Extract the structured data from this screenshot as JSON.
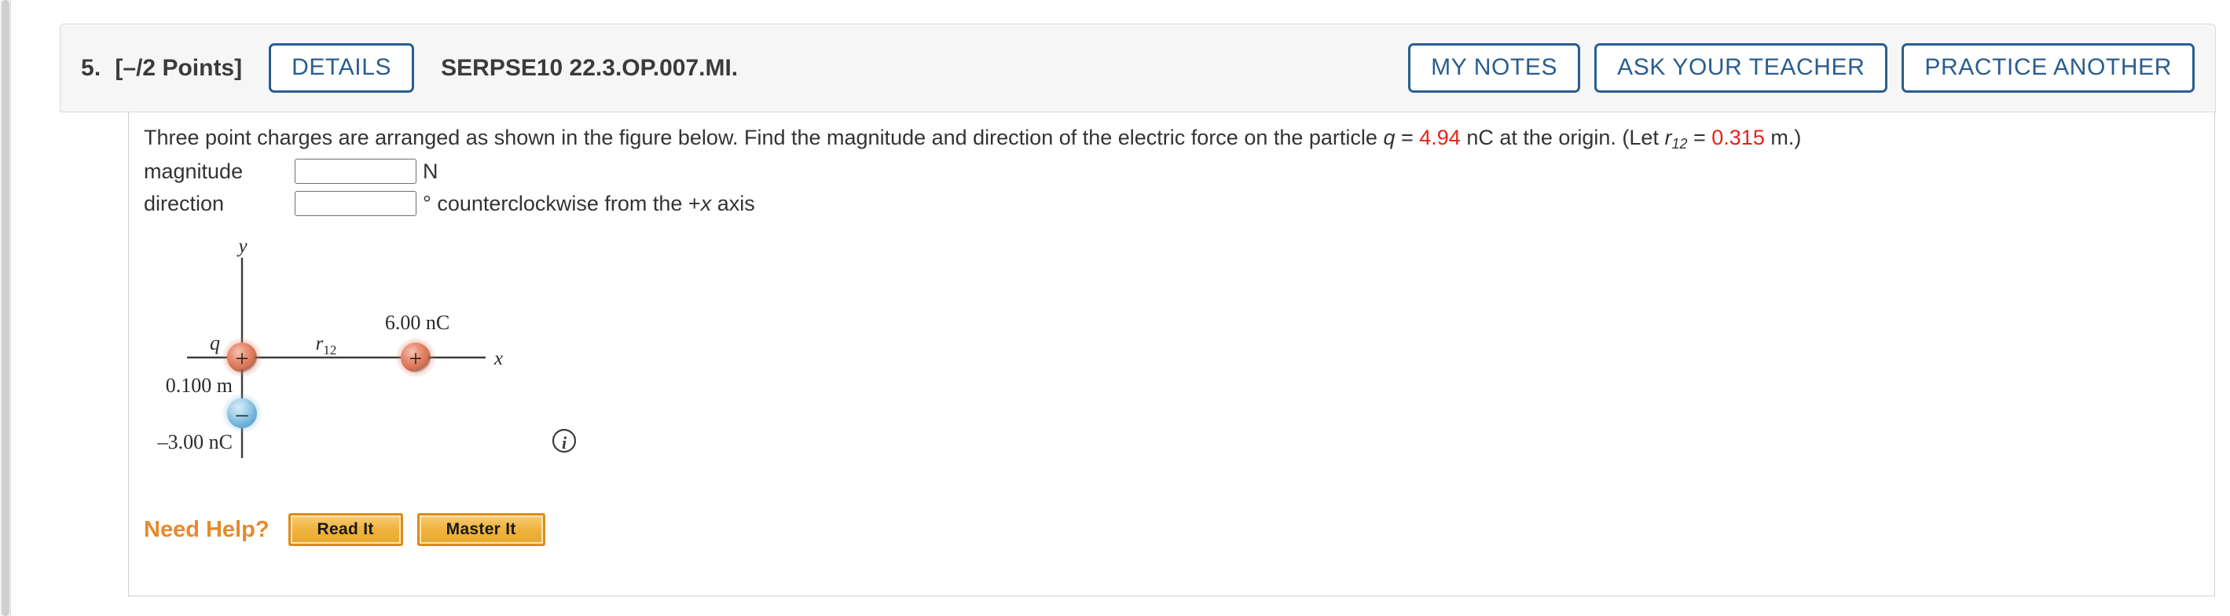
{
  "header": {
    "question_number": "5.",
    "points": "[–/2 Points]",
    "details_label": "DETAILS",
    "question_code": "SERPSE10 22.3.OP.007.MI.",
    "actions": [
      {
        "label": "MY NOTES",
        "name": "my-notes-button"
      },
      {
        "label": "ASK YOUR TEACHER",
        "name": "ask-your-teacher-button"
      },
      {
        "label": "PRACTICE ANOTHER",
        "name": "practice-another-button"
      }
    ]
  },
  "prompt": {
    "text_part1": "Three point charges are arranged as shown in the figure below. Find the magnitude and direction of the electric force on the particle ",
    "var_q": "q",
    "eq1": " = ",
    "value_q": "4.94",
    "text_part2": " nC at the origin. (Let ",
    "var_r": "r",
    "sub_r": "12",
    "eq2": " = ",
    "value_r": "0.315",
    "text_part3": " m.)"
  },
  "answers": {
    "magnitude": {
      "label": "magnitude",
      "value": "",
      "placeholder": "",
      "unit": "N"
    },
    "direction": {
      "label": "direction",
      "value": "",
      "placeholder": "",
      "unit_symbol": "°",
      "unit_text_a": " counterclockwise from the +",
      "unit_var": "x",
      "unit_text_b": " axis"
    }
  },
  "figure": {
    "axis_label_y": "y",
    "axis_label_x": "x",
    "charge_origin_label": "q",
    "charge_origin_sign": "+",
    "charge_right_label": "6.00 nC",
    "charge_right_sign": "+",
    "charge_bottom_label": "–3.00 nC",
    "charge_bottom_sign": "–",
    "distance_label_y": "0.100 m",
    "distance_label_x_var": "r",
    "distance_label_x_sub": "12",
    "info_icon_glyph": "i",
    "colors": {
      "positive_charge": "#e07a5f",
      "negative_charge": "#7fb9dd",
      "axis": "#3c3c3c"
    }
  },
  "need_help": {
    "label": "Need Help?",
    "buttons": [
      {
        "label": "Read It",
        "name": "read-it-button"
      },
      {
        "label": "Master It",
        "name": "master-it-button"
      }
    ]
  },
  "colors": {
    "accent_blue": "#2a5d8f",
    "accent_orange": "#e8892b",
    "value_red": "#e8221a",
    "panel_gray": "#f6f6f6"
  }
}
